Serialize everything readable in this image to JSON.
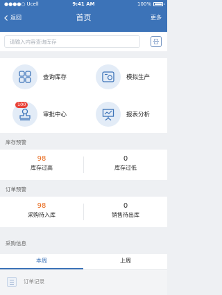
{
  "status_bar": {
    "carrier": "Ucell",
    "time": "9:41 AM",
    "battery": "100%"
  },
  "nav": {
    "back_label": "返回",
    "title": "首页",
    "more_label": "更多"
  },
  "search": {
    "placeholder": "请输入内容查询库存"
  },
  "menu": [
    {
      "label": "查询库存",
      "icon": "inventory-query-icon"
    },
    {
      "label": "模拟生产",
      "icon": "simulate-production-icon"
    },
    {
      "label": "审批中心",
      "icon": "approval-stamp-icon",
      "badge": "100"
    },
    {
      "label": "报表分析",
      "icon": "report-chart-icon"
    }
  ],
  "inventory_alert": {
    "title": "库存预警",
    "stats": [
      {
        "value": "98",
        "label": "库存过高",
        "color": "#e86a1d"
      },
      {
        "value": "0",
        "label": "库存过低",
        "color": "#333333"
      }
    ]
  },
  "order_alert": {
    "title": "订单预警",
    "stats": [
      {
        "value": "98",
        "label": "采购待入库",
        "color": "#e86a1d"
      },
      {
        "value": "0",
        "label": "销售待出库",
        "color": "#333333"
      }
    ]
  },
  "purchase_info": {
    "title": "采购信息",
    "tabs": [
      {
        "label": "本周",
        "active": true
      },
      {
        "label": "上周",
        "active": false
      }
    ],
    "row_label": "订单记录"
  },
  "colors": {
    "brand": "#3c73b8",
    "alert": "#e86a1d",
    "badge": "#e94238"
  }
}
